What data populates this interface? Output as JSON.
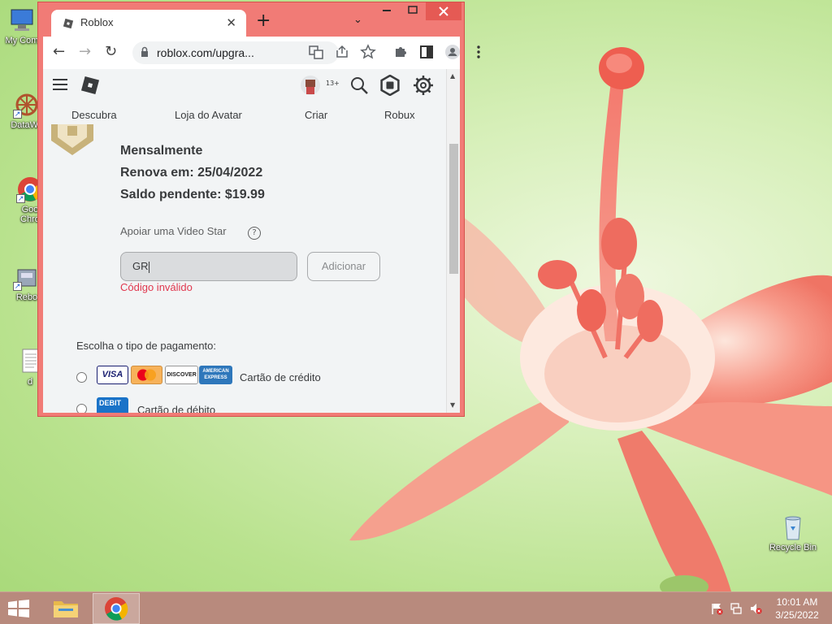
{
  "desktop": {
    "icons": [
      {
        "label": "My Com"
      },
      {
        "label": "DataWa"
      },
      {
        "label": "Goo\nChro"
      },
      {
        "label": "Rebo"
      },
      {
        "label": "d"
      },
      {
        "label": "Recycle Bin"
      }
    ]
  },
  "browser": {
    "tab_title": "Roblox",
    "url": "roblox.com/upgra...",
    "new_tab": "+",
    "tab_search": "⌄"
  },
  "roblox": {
    "nav": [
      "Descubra",
      "Loja do Avatar",
      "Criar",
      "Robux"
    ],
    "age_badge": "13+",
    "plan": {
      "period": "Mensalmente",
      "renews": "Renova em: 25/04/2022",
      "balance": "Saldo pendente: $19.99"
    },
    "support_label": "Apoiar uma Video Star",
    "help": "?",
    "code_value": "GR",
    "add_button": "Adicionar",
    "error_text": "Código inválido",
    "payment_label": "Escolha o tipo de pagamento:",
    "credit_label": "Cartão de crédito",
    "debit_label": "Cartão de débito",
    "cards": [
      "VISA",
      "MasterCard",
      "DISCOVER",
      "AMERICAN EXPRESS"
    ],
    "debit_badge": "DEBIT"
  },
  "taskbar": {
    "time": "10:01 AM",
    "date": "3/25/2022"
  },
  "colors": {
    "window_frame": "#f17b76",
    "error": "#e0384f",
    "taskbar": "#b88a7d"
  }
}
